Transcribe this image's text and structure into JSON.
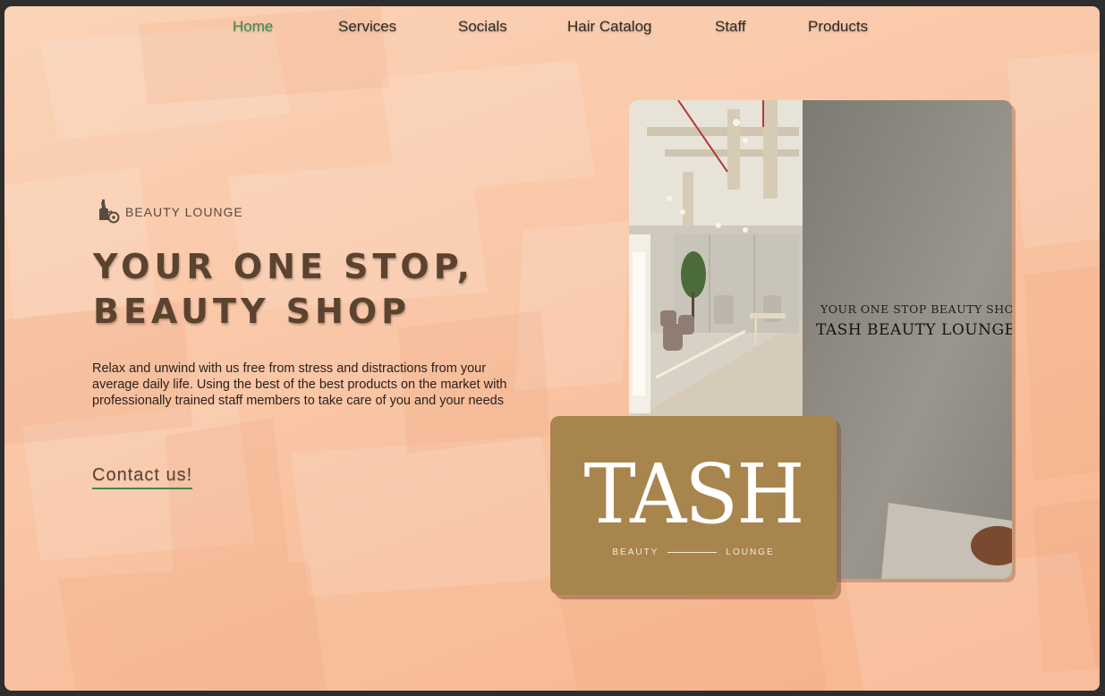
{
  "nav": {
    "items": [
      {
        "label": "Home",
        "active": true
      },
      {
        "label": "Services",
        "active": false
      },
      {
        "label": "Socials",
        "active": false
      },
      {
        "label": "Hair Catalog",
        "active": false
      },
      {
        "label": "Staff",
        "active": false
      },
      {
        "label": "Products",
        "active": false
      }
    ]
  },
  "hero": {
    "brand_icon": "salon-icon",
    "brand_label": "BEAUTY LOUNGE",
    "headline_line1": "YOUR ONE STOP,",
    "headline_line2": "BEAUTY SHOP",
    "description": "Relax and unwind with us free from stress and distractions from your average daily life. Using the best of the best products on the market with professionally trained staff members to take care of you and your needs",
    "cta_label": "Contact us!"
  },
  "photo": {
    "wall_text_small": "YOUR ONE STOP BEAUTY SHOP",
    "wall_text_large": "TASH BEAUTY LOUNGE"
  },
  "logo": {
    "main": "TASH",
    "sub_left": "BEAUTY",
    "sub_right": "LOUNGE"
  },
  "colors": {
    "accent_green": "#3f8a4b",
    "heading_brown": "#5b4330",
    "logo_gold": "#a8854d",
    "background_peach": "#f9c6a6"
  }
}
